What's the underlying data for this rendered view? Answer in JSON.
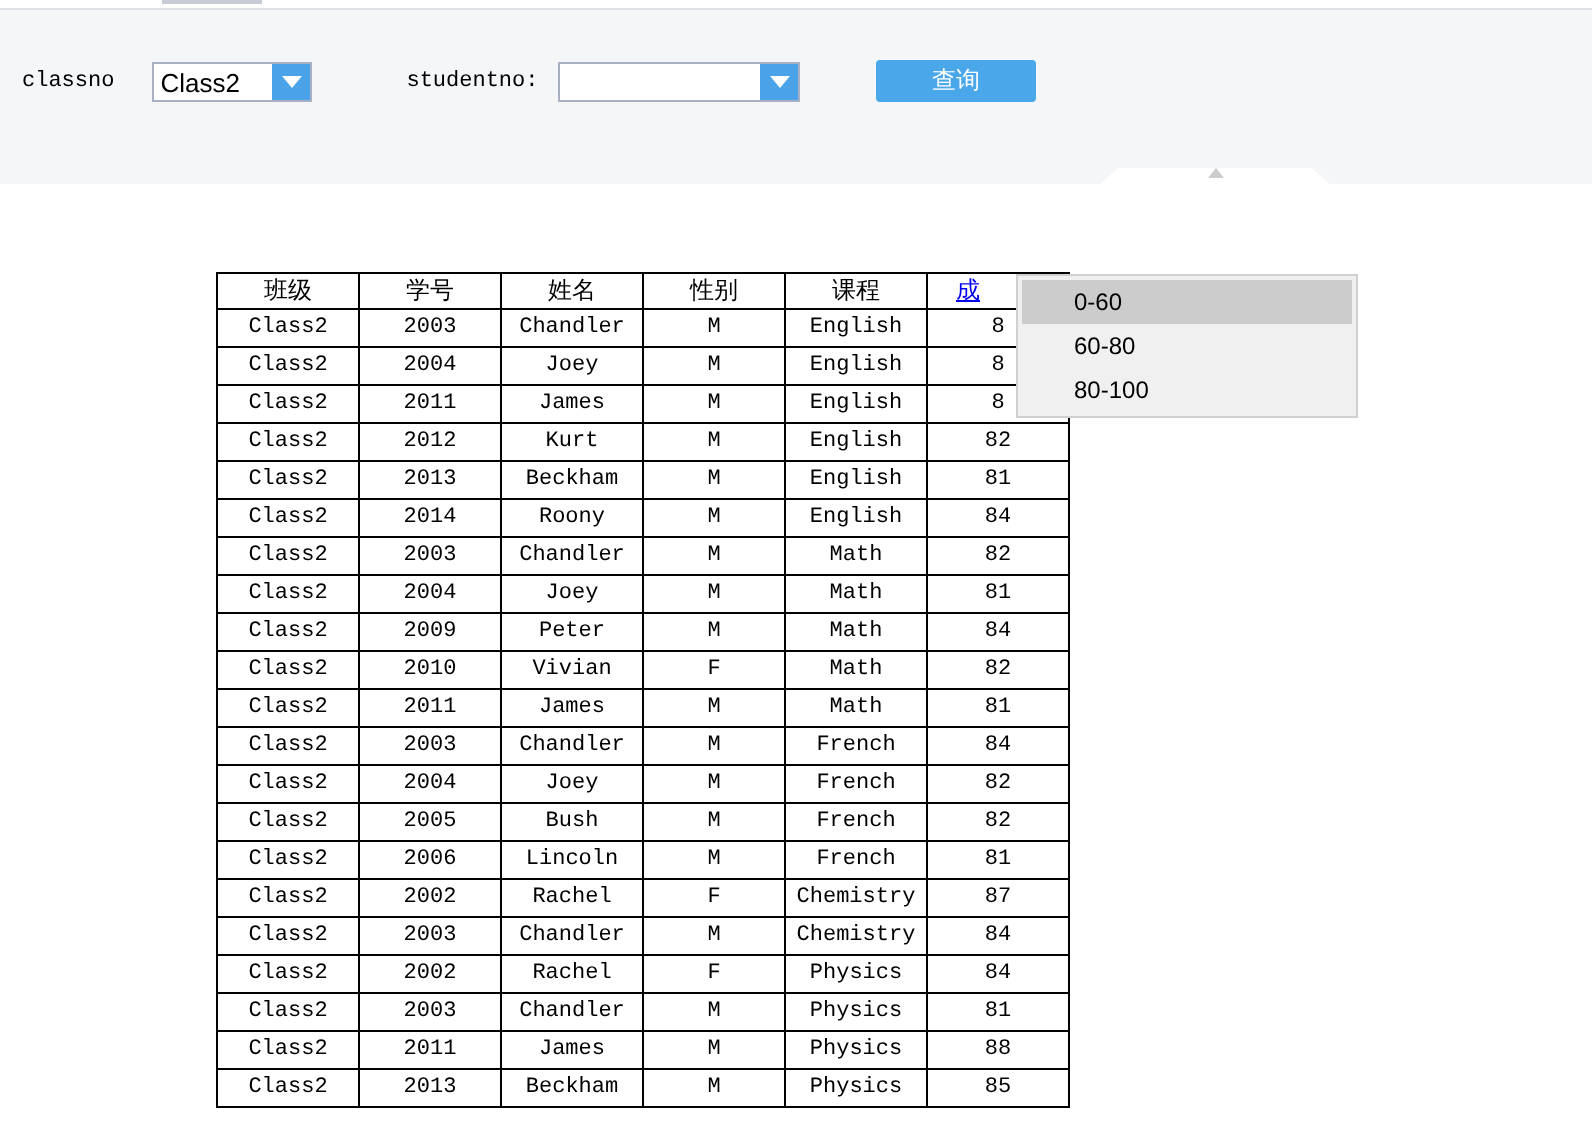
{
  "filters": {
    "classno": {
      "label": "classno",
      "value": "Class2"
    },
    "studentno": {
      "label": "studentno:"
    },
    "query_button": "查询"
  },
  "table": {
    "columns": [
      "班级",
      "学号",
      "姓名",
      "性别",
      "课程",
      "成"
    ],
    "rows": [
      [
        "Class2",
        "2003",
        "Chandler",
        "M",
        "English",
        "8"
      ],
      [
        "Class2",
        "2004",
        "Joey",
        "M",
        "English",
        "8"
      ],
      [
        "Class2",
        "2011",
        "James",
        "M",
        "English",
        "8"
      ],
      [
        "Class2",
        "2012",
        "Kurt",
        "M",
        "English",
        "82"
      ],
      [
        "Class2",
        "2013",
        "Beckham",
        "M",
        "English",
        "81"
      ],
      [
        "Class2",
        "2014",
        "Roony",
        "M",
        "English",
        "84"
      ],
      [
        "Class2",
        "2003",
        "Chandler",
        "M",
        "Math",
        "82"
      ],
      [
        "Class2",
        "2004",
        "Joey",
        "M",
        "Math",
        "81"
      ],
      [
        "Class2",
        "2009",
        "Peter",
        "M",
        "Math",
        "84"
      ],
      [
        "Class2",
        "2010",
        "Vivian",
        "F",
        "Math",
        "82"
      ],
      [
        "Class2",
        "2011",
        "James",
        "M",
        "Math",
        "81"
      ],
      [
        "Class2",
        "2003",
        "Chandler",
        "M",
        "French",
        "84"
      ],
      [
        "Class2",
        "2004",
        "Joey",
        "M",
        "French",
        "82"
      ],
      [
        "Class2",
        "2005",
        "Bush",
        "M",
        "French",
        "82"
      ],
      [
        "Class2",
        "2006",
        "Lincoln",
        "M",
        "French",
        "81"
      ],
      [
        "Class2",
        "2002",
        "Rachel",
        "F",
        "Chemistry",
        "87"
      ],
      [
        "Class2",
        "2003",
        "Chandler",
        "M",
        "Chemistry",
        "84"
      ],
      [
        "Class2",
        "2002",
        "Rachel",
        "F",
        "Physics",
        "84"
      ],
      [
        "Class2",
        "2003",
        "Chandler",
        "M",
        "Physics",
        "81"
      ],
      [
        "Class2",
        "2011",
        "James",
        "M",
        "Physics",
        "88"
      ],
      [
        "Class2",
        "2013",
        "Beckham",
        "M",
        "Physics",
        "85"
      ]
    ]
  },
  "score_menu": [
    {
      "label": "0-60",
      "selected": true
    },
    {
      "label": "60-80",
      "selected": false
    },
    {
      "label": "80-100",
      "selected": false
    }
  ]
}
